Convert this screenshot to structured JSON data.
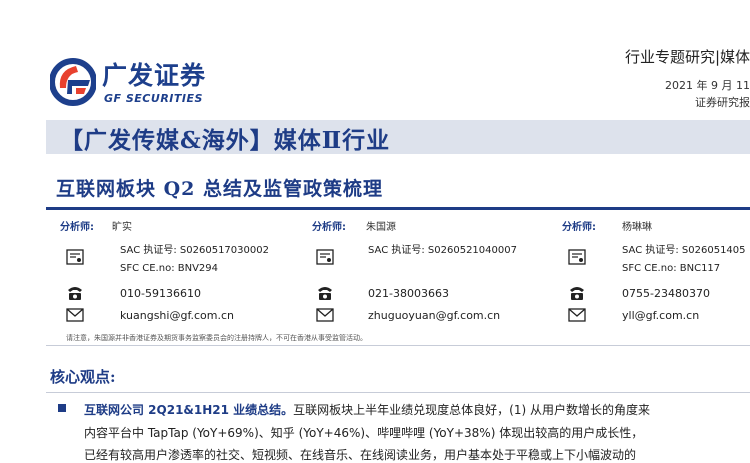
{
  "logo": {
    "cn": "广发证券",
    "en": "GF SECURITIES"
  },
  "header": {
    "report_type": "行业专题研究|媒体",
    "date": "2021 年 9 月 11",
    "kind": "证券研究报"
  },
  "title": {
    "main": "【广发传媒&海外】媒体Ⅱ行业",
    "sub": "互联网板块 Q2 总结及监管政策梳理"
  },
  "analysts": [
    {
      "label": "分析师:",
      "name": "旷实",
      "sac": "SAC 执证号: S0260517030002",
      "sfc": "SFC CE.no: BNV294",
      "phone": "010-59136610",
      "email": "kuangshi@gf.com.cn"
    },
    {
      "label": "分析师:",
      "name": "朱国源",
      "sac": "SAC 执证号: S0260521040007",
      "sfc": "",
      "phone": "021-38003663",
      "email": "zhuguoyuan@gf.com.cn"
    },
    {
      "label": "分析师:",
      "name": "杨琳琳",
      "sac": "SAC 执证号: S026051405",
      "sfc": "SFC CE.no: BNC117",
      "phone": "0755-23480370",
      "email": "yll@gf.com.cn"
    }
  ],
  "note": "请注意，朱国源并非香港证券及期货事务监察委员会的注册持牌人，不可在香港从事受监管活动。",
  "core": {
    "title": "核心观点:",
    "bullet_head": "互联网公司 2Q21&1H21 业绩总结。",
    "line1": "互联网板块上半年业绩兑现度总体良好，(1) 从用户数增长的角度来",
    "line2": "内容平台中 TapTap (YoY+69%)、知乎 (YoY+46%)、哔哩哔哩 (YoY+38%) 体现出较高的用户成长性，",
    "line3": "已经有较高用户渗透率的社交、短视频、在线音乐、在线阅读业务，用户基本处于平稳或上下小幅波动的"
  },
  "colors": {
    "brand": "#1e3c86",
    "logo_red": "#e8412e",
    "title_bar": "#dde2ec"
  }
}
